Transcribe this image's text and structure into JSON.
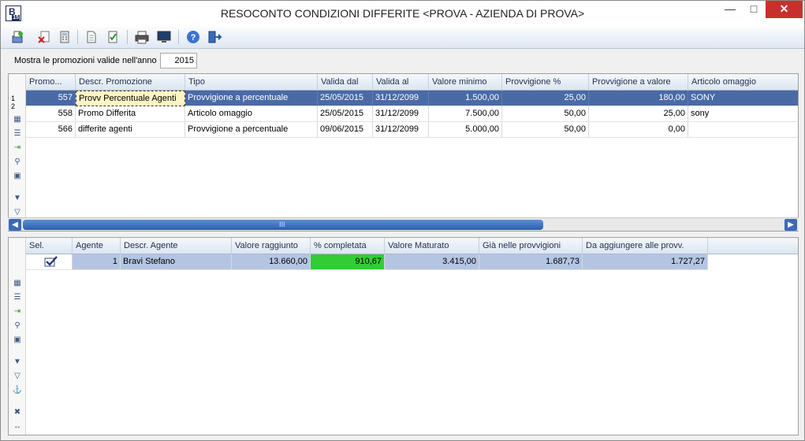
{
  "window": {
    "title": "RESOCONTO CONDIZIONI DIFFERITE <PROVA - AZIENDA DI PROVA>",
    "app_icon_letter": "B",
    "app_icon_number": "15",
    "minimize_label": "—",
    "maximize_label": "□",
    "close_label": "✕"
  },
  "toolbar": {
    "buttons": [
      "new-record-icon",
      "delete-icon",
      "calculator-icon",
      "document-icon",
      "checklist-icon",
      "print-icon",
      "monitor-icon",
      "help-icon",
      "exit-door-icon"
    ]
  },
  "filter": {
    "label": "Mostra le promozioni valide nell'anno",
    "year": "2015"
  },
  "promotions": {
    "columns": [
      "Promo...",
      "Descr. Promozione",
      "Tipo",
      "Valida dal",
      "Valida al",
      "Valore minimo",
      "Provvigione %",
      "Provvigione a valore",
      "Articolo omaggio"
    ],
    "row_numbers": [
      "1",
      "2"
    ],
    "rows": [
      [
        "557",
        "Provv Percentuale Agenti",
        "Provvigione a percentuale",
        "25/05/2015",
        "31/12/2099",
        "1.500,00",
        "25,00",
        "180,00",
        "SONY"
      ],
      [
        "558",
        "Promo Differita",
        "Articolo omaggio",
        "25/05/2015",
        "31/12/2099",
        "7.500,00",
        "50,00",
        "25,00",
        "sony"
      ],
      [
        "566",
        "differite agenti",
        "Provvigione a percentuale",
        "09/06/2015",
        "31/12/2099",
        "5.000,00",
        "50,00",
        "0,00",
        ""
      ]
    ],
    "scroll_grip": "III"
  },
  "agents": {
    "columns": [
      "Sel.",
      "Agente",
      "Descr. Agente",
      "Valore raggiunto",
      "% completata",
      "Valore Maturato",
      "Già nelle provvigioni",
      "Da aggiungere alle provv."
    ],
    "rows": [
      [
        "",
        "1",
        "Bravi Stefano",
        "13.660,00",
        "910,67",
        "3.415,00",
        "1.687,73",
        "1.727,27"
      ]
    ]
  },
  "colors": {
    "selected_row": "#4a6aa5",
    "agent_row": "#b4c5e4",
    "completed_cell": "#33cc33",
    "close_button": "#c7312b"
  }
}
